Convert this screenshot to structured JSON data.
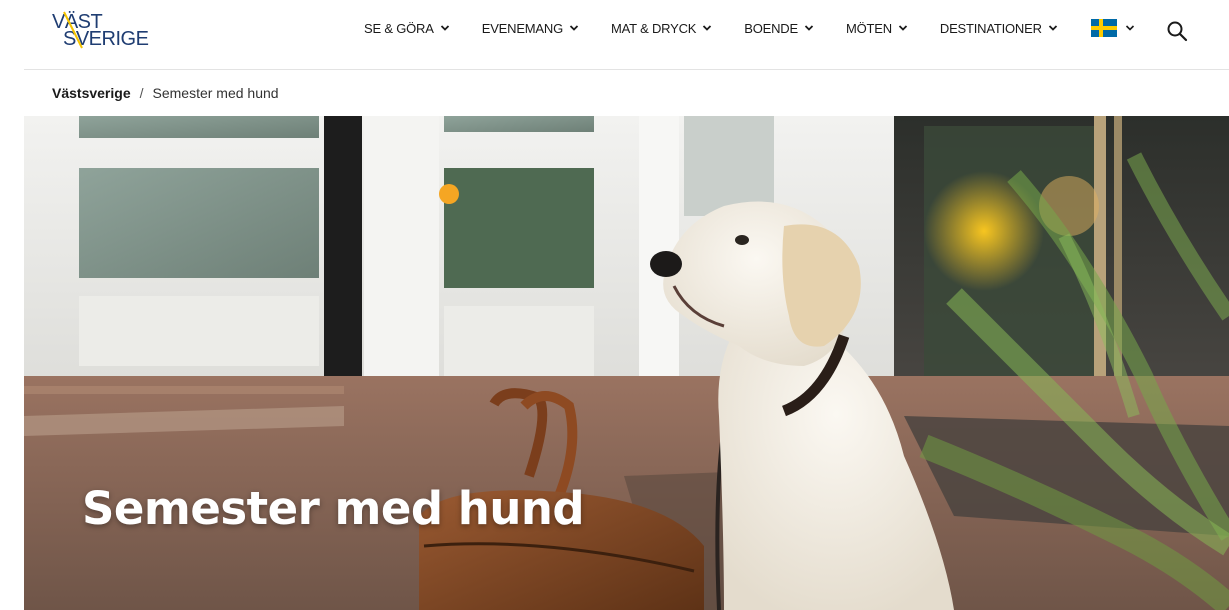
{
  "brand": {
    "logo_line1": "VÄST",
    "logo_line2": "SVERIGE"
  },
  "nav": {
    "items": [
      {
        "label": "SE & GÖRA"
      },
      {
        "label": "EVENEMANG"
      },
      {
        "label": "MAT & DRYCK"
      },
      {
        "label": "BOENDE"
      },
      {
        "label": "MÖTEN"
      },
      {
        "label": "DESTINATIONER"
      }
    ],
    "language_icon": "swedish-flag-icon",
    "search_icon": "search-icon"
  },
  "breadcrumb": {
    "home": "Västsverige",
    "separator": "/",
    "current": "Semester med hund"
  },
  "hero": {
    "title": "Semester med hund",
    "image_icon": "hero-photo"
  },
  "colors": {
    "brand_blue": "#1f3d72",
    "brand_yellow": "#f5c400",
    "flag_blue": "#006aa7",
    "flag_yellow": "#fecc00"
  }
}
